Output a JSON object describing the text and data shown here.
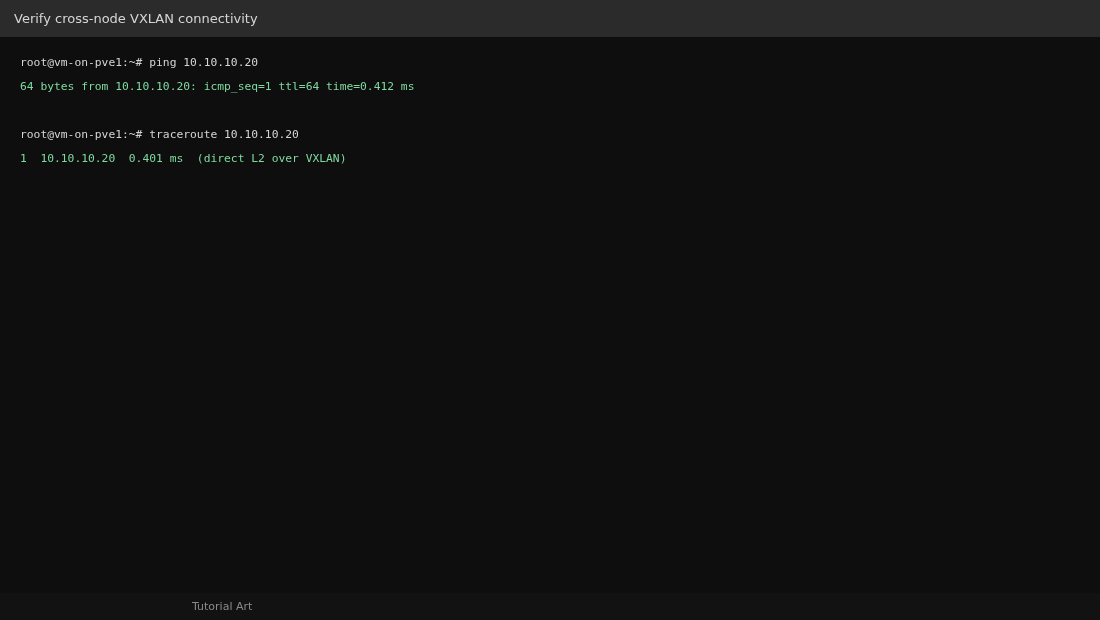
{
  "window": {
    "title": "Verify cross-node VXLAN connectivity"
  },
  "terminal": {
    "lines": [
      {
        "kind": "prompt",
        "text": "root@vm-on-pve1:~# ping 10.10.10.20"
      },
      {
        "kind": "output",
        "text": "64 bytes from 10.10.10.20: icmp_seq=1 ttl=64 time=0.412 ms"
      },
      {
        "kind": "blank"
      },
      {
        "kind": "prompt",
        "text": "root@vm-on-pve1:~# traceroute 10.10.10.20"
      },
      {
        "kind": "output",
        "text": "1  10.10.10.20  0.401 ms  (direct L2 over VXLAN)"
      }
    ]
  },
  "footer": {
    "text": "Tutorial Art"
  }
}
